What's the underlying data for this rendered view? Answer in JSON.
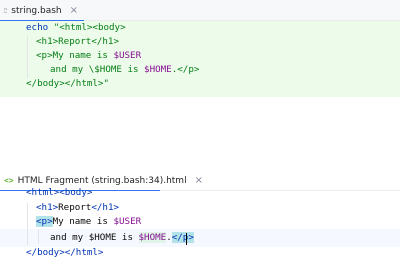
{
  "top_tab": {
    "label": "string.bash",
    "close": "×"
  },
  "top_code": {
    "line1_kw": "echo",
    "line1_str": "\"<html><body>",
    "line2": "<h1>Report</h1>",
    "line3_text": "<p>My name is ",
    "line3_var": "$USER",
    "line4_text": "and my \\$HOME is ",
    "line4_var": "$HOME",
    "line4_end": ".</p>",
    "line5": "</body></html>\""
  },
  "bottom_tab": {
    "icon": "<>",
    "label": "HTML Fragment (string.bash:34).html",
    "close": "×"
  },
  "bottom_code": {
    "l1": "<html><body>",
    "l2_open": "<h1>",
    "l2_text": "Report",
    "l2_close": "</h1>",
    "l3_open": "<p>",
    "l3_text": "My name is ",
    "l3_var": "$USER",
    "l4_text": "and my $HOME is ",
    "l4_var": "$HOME",
    "l4_dot": ".",
    "l4_close": "</p>",
    "l5": "</body></html>"
  }
}
